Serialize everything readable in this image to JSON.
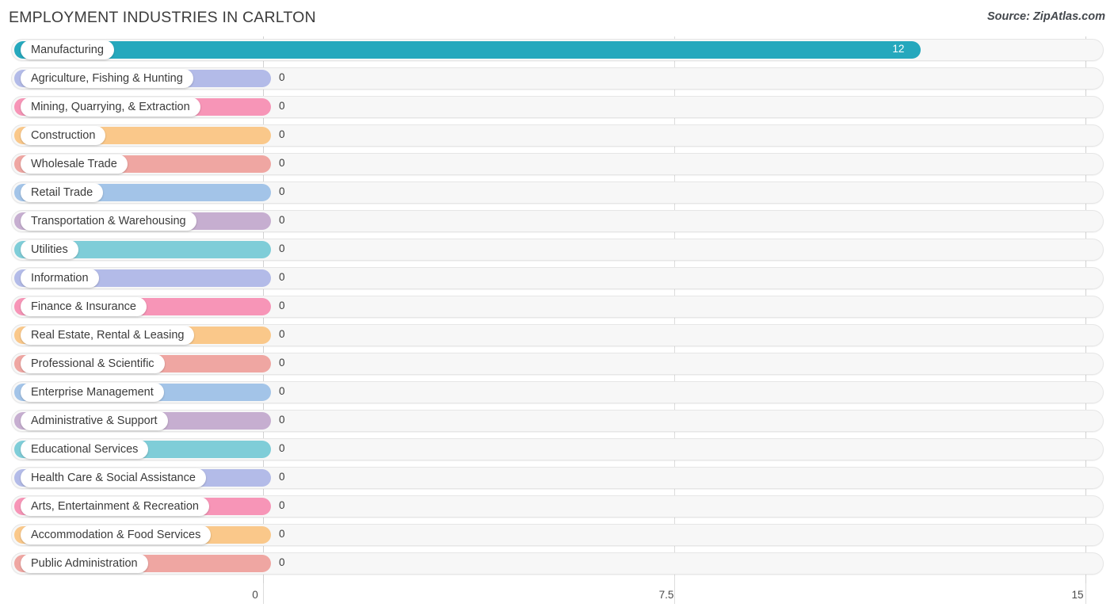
{
  "header": {
    "title": "EMPLOYMENT INDUSTRIES IN CARLTON",
    "source": "Source: ZipAtlas.com"
  },
  "chart_data": {
    "type": "bar",
    "orientation": "horizontal",
    "title": "EMPLOYMENT INDUSTRIES IN CARLTON",
    "xlabel": "",
    "ylabel": "",
    "xlim": [
      0,
      15
    ],
    "xticks": [
      "0",
      "7.5",
      "15"
    ],
    "xtick_values": [
      0,
      7.5,
      15
    ],
    "grid": true,
    "legend": "none",
    "categories": [
      "Manufacturing",
      "Agriculture, Fishing & Hunting",
      "Mining, Quarrying, & Extraction",
      "Construction",
      "Wholesale Trade",
      "Retail Trade",
      "Transportation & Warehousing",
      "Utilities",
      "Information",
      "Finance & Insurance",
      "Real Estate, Rental & Leasing",
      "Professional & Scientific",
      "Enterprise Management",
      "Administrative & Support",
      "Educational Services",
      "Health Care & Social Assistance",
      "Arts, Entertainment & Recreation",
      "Accommodation & Food Services",
      "Public Administration"
    ],
    "values": [
      12,
      0,
      0,
      0,
      0,
      0,
      0,
      0,
      0,
      0,
      0,
      0,
      0,
      0,
      0,
      0,
      0,
      0,
      0
    ],
    "value_labels": [
      "12",
      "0",
      "0",
      "0",
      "0",
      "0",
      "0",
      "0",
      "0",
      "0",
      "0",
      "0",
      "0",
      "0",
      "0",
      "0",
      "0",
      "0",
      "0"
    ],
    "colors": [
      "#25a8bd",
      "#b3bbe8",
      "#f795b7",
      "#fac88a",
      "#efa6a2",
      "#a3c4e8",
      "#c6aed0",
      "#7fcdd8",
      "#b3bbe8",
      "#f795b7",
      "#fac88a",
      "#efa6a2",
      "#a3c4e8",
      "#c6aed0",
      "#7fcdd8",
      "#b3bbe8",
      "#f795b7",
      "#fac88a",
      "#efa6a2"
    ]
  }
}
